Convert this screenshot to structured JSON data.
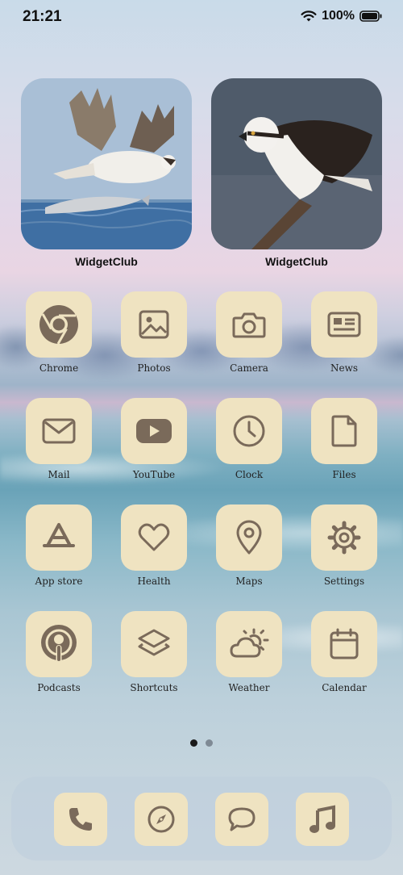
{
  "status_bar": {
    "time": "21:21",
    "battery_percent": "100%"
  },
  "widgets": [
    {
      "label": "WidgetClub"
    },
    {
      "label": "WidgetClub"
    }
  ],
  "apps": [
    {
      "label": "Chrome",
      "icon": "chrome-icon"
    },
    {
      "label": "Photos",
      "icon": "photos-icon"
    },
    {
      "label": "Camera",
      "icon": "camera-icon"
    },
    {
      "label": "News",
      "icon": "news-icon"
    },
    {
      "label": "Mail",
      "icon": "mail-icon"
    },
    {
      "label": "YouTube",
      "icon": "youtube-icon"
    },
    {
      "label": "Clock",
      "icon": "clock-icon"
    },
    {
      "label": "Files",
      "icon": "files-icon"
    },
    {
      "label": "App store",
      "icon": "app-store-icon"
    },
    {
      "label": "Health",
      "icon": "heart-icon"
    },
    {
      "label": "Maps",
      "icon": "map-pin-icon"
    },
    {
      "label": "Settings",
      "icon": "gear-icon"
    },
    {
      "label": "Podcasts",
      "icon": "podcasts-icon"
    },
    {
      "label": "Shortcuts",
      "icon": "shortcuts-icon"
    },
    {
      "label": "Weather",
      "icon": "weather-icon"
    },
    {
      "label": "Calendar",
      "icon": "calendar-icon"
    }
  ],
  "page_indicator": {
    "current": 1,
    "total": 2
  },
  "dock": [
    {
      "icon": "phone-icon"
    },
    {
      "icon": "compass-icon"
    },
    {
      "icon": "message-icon"
    },
    {
      "icon": "music-icon"
    }
  ],
  "colors": {
    "icon_tile": "#efe3c1",
    "icon_glyph": "#7a6a5a",
    "dot_active": "#1a1a1a",
    "dot_inactive": "#7f8a95"
  }
}
